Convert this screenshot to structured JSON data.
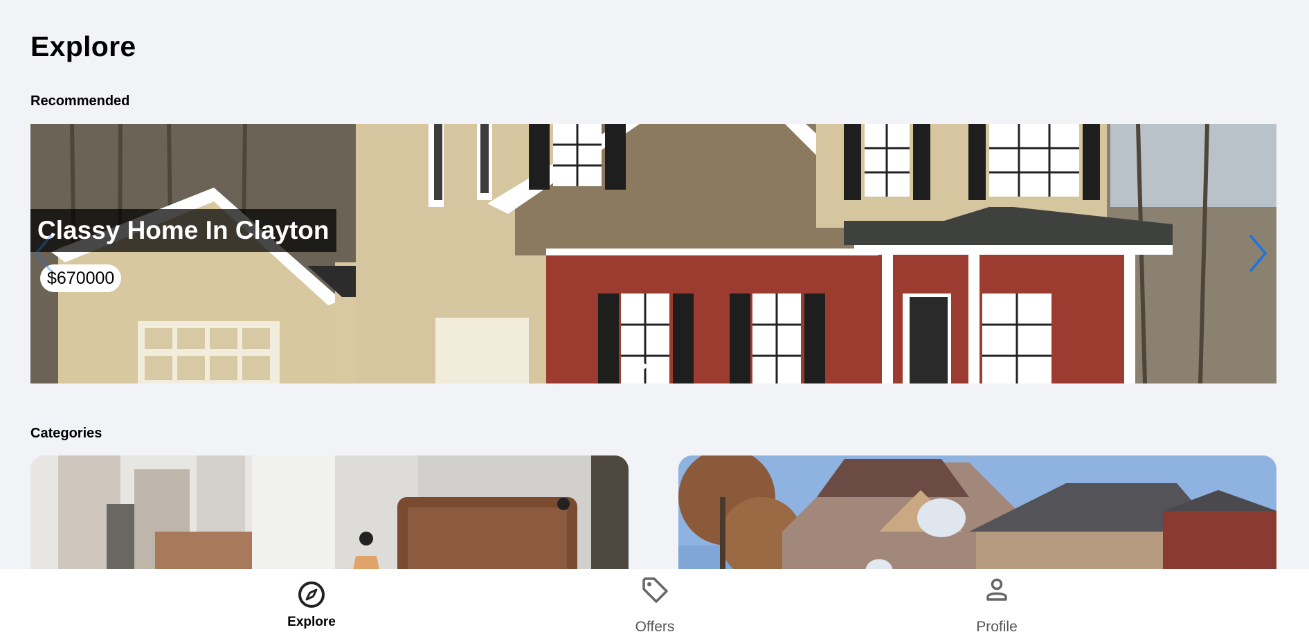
{
  "page": {
    "title": "Explore"
  },
  "recommended": {
    "heading": "Recommended",
    "listing": {
      "title": "Classy Home In Clayton",
      "price": "$670000"
    },
    "nav_prev_icon": "chevron-left-icon",
    "nav_next_icon": "chevron-right-icon",
    "accent_color": "#1a73e8"
  },
  "categories": {
    "heading": "Categories",
    "cards": [
      {
        "image": "apartment-bedroom-photo"
      },
      {
        "image": "suburban-house-photo"
      }
    ]
  },
  "bottom_nav": {
    "items": [
      {
        "label": "Explore",
        "icon": "compass-icon",
        "active": true
      },
      {
        "label": "Offers",
        "icon": "tag-icon",
        "active": false
      },
      {
        "label": "Profile",
        "icon": "person-icon",
        "active": false
      }
    ]
  }
}
